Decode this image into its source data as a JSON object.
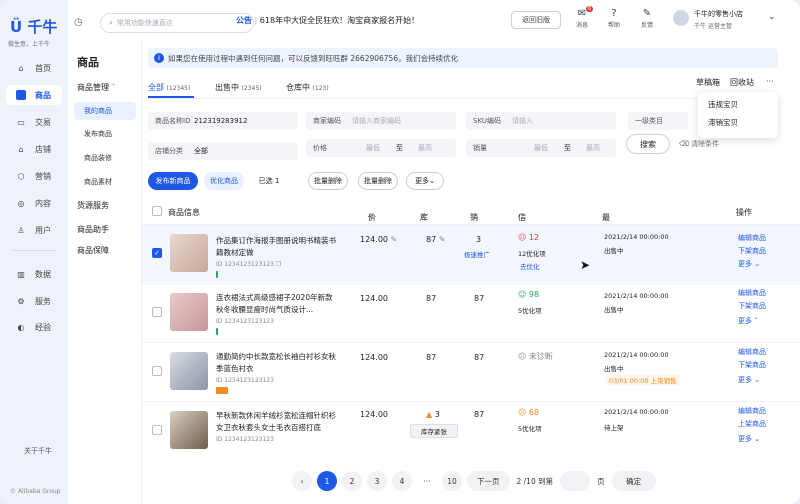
{
  "brand": {
    "name": "千牛",
    "slogan": "做生意，上千牛",
    "copyright": "© Alibaba Group"
  },
  "nav": [
    {
      "label": "首页",
      "icon": "home-icon"
    },
    {
      "label": "商品",
      "icon": "product-icon"
    },
    {
      "label": "交易",
      "icon": "trade-icon"
    },
    {
      "label": "店铺",
      "icon": "store-icon"
    },
    {
      "label": "营销",
      "icon": "marketing-icon"
    },
    {
      "label": "内容",
      "icon": "content-icon"
    },
    {
      "label": "用户",
      "icon": "user-icon"
    },
    {
      "label": "数据",
      "icon": "data-icon"
    },
    {
      "label": "服务",
      "icon": "service-icon"
    },
    {
      "label": "经验",
      "icon": "experience-icon"
    }
  ],
  "nav_bottom": "关于千牛",
  "topbar": {
    "search_placeholder": "常用功能快速直达",
    "announce_tag": "公告",
    "announce_sep": "|",
    "announce": "618年中大促全民狂欢！淘宝商家报名开始！",
    "old_version": "返回旧版",
    "icons": [
      {
        "label": "消息",
        "badge": "6"
      },
      {
        "label": "帮助"
      },
      {
        "label": "反馈"
      }
    ],
    "shop_name": "千牛的零售小店",
    "shop_role": "千牛",
    "shop_role2": "运营主管"
  },
  "side": {
    "title": "商品",
    "group1": "商品管理",
    "items": [
      "我的商品",
      "发布商品",
      "商品装修",
      "商品素材"
    ],
    "group2": "货源服务",
    "group3": "商品助手",
    "group4": "商品保障"
  },
  "info": "如果您在使用过程中遇到任何问题，可以反馈到旺旺群 2662906756，我们会持续优化",
  "tabs": [
    {
      "label": "全部",
      "count": "(12345)"
    },
    {
      "label": "出售中",
      "count": "(2345)"
    },
    {
      "label": "仓库中",
      "count": "(123)"
    }
  ],
  "right_links": [
    "草稿箱",
    "回收站",
    "···"
  ],
  "dropdown": [
    "违规宝贝",
    "滞销宝贝"
  ],
  "filters": {
    "name_label": "商品名称ID",
    "name_value": "212319283912",
    "code_label": "商家编码",
    "code_ph": "请输入商家编码",
    "sku_label": "SKU编码",
    "sku_ph": "请输入",
    "cat_label": "一级类目",
    "shopcat_label": "店铺分类",
    "shopcat_value": "全部",
    "price_label": "价格",
    "sales_label": "销量",
    "min": "最低",
    "max": "最高",
    "to": "至",
    "query": "搜索",
    "clear": "清除条件"
  },
  "actions": {
    "publish": "发布新商品",
    "optimize": "优化商品",
    "selected": "已选 1",
    "batch_del": "批量删除",
    "batch_del2": "批量删除",
    "more": "更多"
  },
  "columns": [
    "商品信息",
    "价格",
    "库存",
    "销量",
    "信息质量",
    "最后修改时间",
    "操作"
  ],
  "rows": [
    {
      "name": "作品集订作海报手图册说明书精装书籍教材定做",
      "id": "ID 1234123123123",
      "price": "124.00",
      "stock": "87",
      "sales": "3",
      "sales_link": "极速推广",
      "quality": "12",
      "quality_text": "12优化项",
      "quality_link": "去优化",
      "time": "2021/2/14 00:00:00",
      "status": "出售中",
      "ops": [
        "编辑商品",
        "下架商品",
        "更多"
      ]
    },
    {
      "name": "连衣裙法式高级感裙子2020年新款秋冬收腰显瘦时尚气质设计...",
      "id": "ID 1234123123123",
      "price": "124.00",
      "stock": "87",
      "sales": "87",
      "quality": "98",
      "quality_text": "5优化项",
      "time": "2021/2/14 00:00:00",
      "status": "出售中",
      "ops": [
        "编辑商品",
        "下架商品",
        "更多"
      ]
    },
    {
      "name": "通勤简约中长款宽松长袖白衬衫女秋季蓝色衬衣",
      "id": "ID 1234123123123",
      "price": "124.00",
      "stock": "87",
      "sales": "87",
      "quality_text": "未诊断",
      "time": "2021/2/14 00:00:00",
      "status": "出售中",
      "note": "03/01 00:00 上架销售",
      "ops": [
        "编辑商品",
        "下架商品",
        "更多"
      ]
    },
    {
      "name": "早秋新款休闲羊绒衫宽松连帽针织衫女卫衣秋套头女士毛衣百搭打底",
      "id": "ID 1234123123123",
      "price": "124.00",
      "stock": "3",
      "stock_btn": "库存紧张",
      "sales": "87",
      "quality": "68",
      "quality_text": "5优化项",
      "time": "2021/2/14 00:00:00",
      "status": "待上架",
      "ops": [
        "编辑商品",
        "上架商品",
        "更多"
      ]
    }
  ],
  "pager": {
    "prev": "‹",
    "pages": [
      "1",
      "2",
      "3",
      "4",
      "···",
      "10"
    ],
    "next": "下一页",
    "info": "2 /10",
    "goto": "到第",
    "unit": "页",
    "confirm": "确定"
  }
}
